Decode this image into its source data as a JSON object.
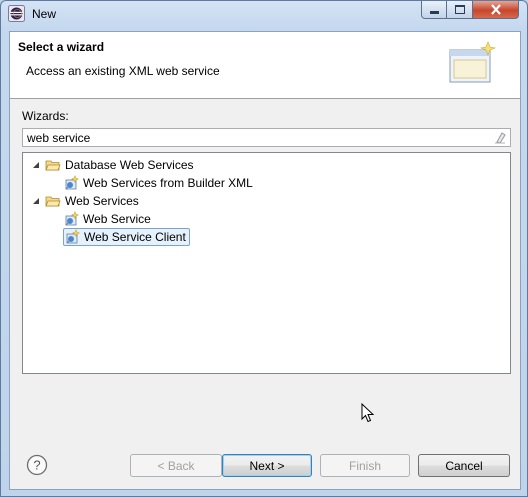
{
  "window": {
    "title": "New"
  },
  "header": {
    "title": "Select a wizard",
    "description": "Access an existing XML web service"
  },
  "wizards": {
    "label": "Wizards:",
    "filter_value": "web service",
    "tree": [
      {
        "label": "Database Web Services",
        "icon": "folder-open-icon",
        "expanded": true
      },
      {
        "label": "Web Services from Builder XML",
        "icon": "web-service-wizard-icon"
      },
      {
        "label": "Web Services",
        "icon": "folder-open-icon",
        "expanded": true
      },
      {
        "label": "Web Service",
        "icon": "web-service-wizard-icon"
      },
      {
        "label": "Web Service Client",
        "icon": "web-service-wizard-icon",
        "selected": true
      }
    ]
  },
  "buttons": {
    "back": "< Back",
    "next": "Next >",
    "finish": "Finish",
    "cancel": "Cancel"
  },
  "colors": {
    "selection": "#e5f1fb",
    "selection_border": "#7da2ce",
    "close_button": "#c7462d"
  }
}
